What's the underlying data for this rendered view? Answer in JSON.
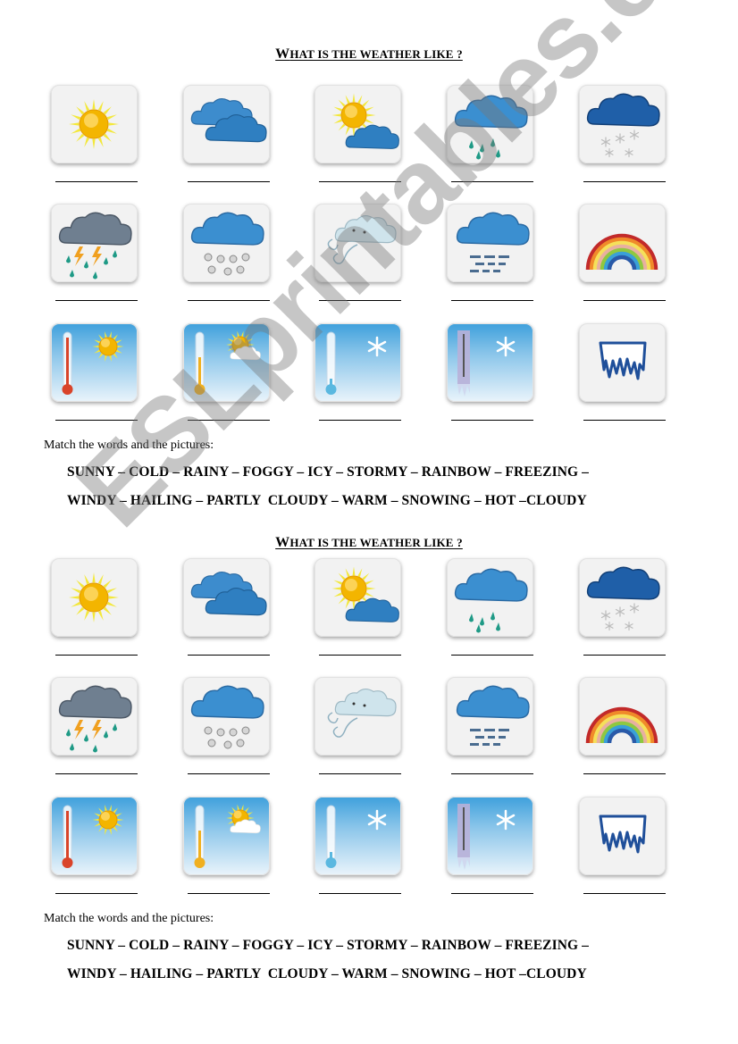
{
  "worksheet": {
    "sections": [
      {
        "title_first": "W",
        "title_rest": "HAT IS THE WEATHER LIKE ?",
        "instruction": "Match the words and the pictures:",
        "word_line_1": "SUNNY – COLD – RAINY – FOGGY – ICY – STORMY – RAINBOW – FREEZING –",
        "word_line_2": "WINDY – HAILING – PARTLY  CLOUDY – WARM – SNOWING – HOT –CLOUDY"
      },
      {
        "title_first": "W",
        "title_rest": "HAT IS THE WEATHER LIKE ?",
        "instruction": "Match the words and the pictures:",
        "word_line_1": "SUNNY – COLD – RAINY – FOGGY – ICY – STORMY – RAINBOW – FREEZING –",
        "word_line_2": "WINDY – HAILING – PARTLY  CLOUDY – WARM – SNOWING – HOT –CLOUDY"
      }
    ],
    "pictures": [
      "sun-icon",
      "clouds-icon",
      "partly-cloudy-icon",
      "rain-cloud-icon",
      "snow-cloud-icon",
      "storm-icon",
      "hail-cloud-icon",
      "wind-cloud-icon",
      "fog-cloud-icon",
      "rainbow-icon",
      "hot-thermometer-icon",
      "warm-thermometer-icon",
      "cold-thermometer-icon",
      "freezing-thermometer-icon",
      "icicles-icon"
    ],
    "answer_blank": ""
  },
  "watermark": "ESLprintables.com",
  "colors": {
    "sun": "#f5c400",
    "cloud": "#2f7fc1",
    "sky": "#3ea0dc",
    "watermark": "#8a8a8a"
  }
}
